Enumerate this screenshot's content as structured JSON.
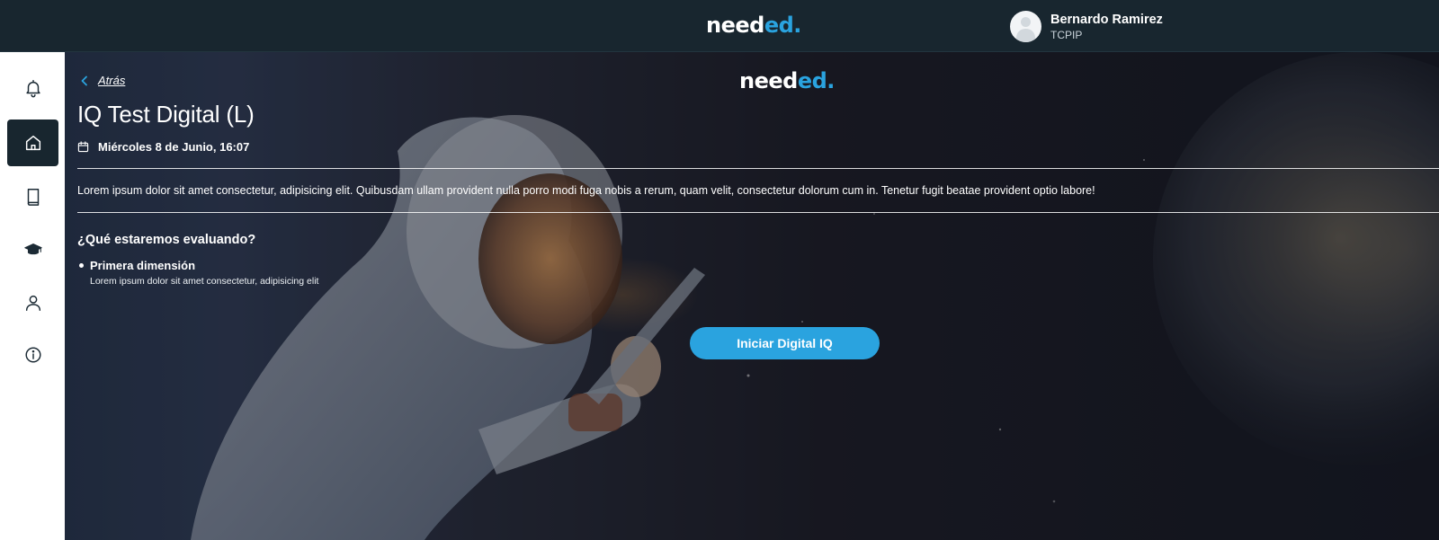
{
  "brand": {
    "logo_main": "need",
    "logo_accent": "ed."
  },
  "user": {
    "name": "Bernardo Ramirez",
    "role": "TCPIP"
  },
  "sidebar": {
    "items": [
      {
        "icon": "bell-icon",
        "active": false
      },
      {
        "icon": "home-icon",
        "active": true
      },
      {
        "icon": "book-icon",
        "active": false
      },
      {
        "icon": "graduation-cap-icon",
        "active": false
      },
      {
        "icon": "user-icon",
        "active": false
      },
      {
        "icon": "info-icon",
        "active": false
      }
    ]
  },
  "page": {
    "back_label": "Atrás",
    "title": "IQ Test Digital (L)",
    "date": "Miércoles 8 de Junio, 16:07",
    "description": "Lorem ipsum dolor sit amet consectetur, adipisicing elit. Quibusdam ullam provident nulla porro modi fuga nobis a rerum, quam velit, consectetur dolorum cum in. Tenetur fugit beatae provident optio labore!",
    "section_title": "¿Qué estaremos evaluando?",
    "dimensions": [
      {
        "title": "Primera dimensión",
        "description": "Lorem ipsum dolor sit amet consectetur, adipisicing elit"
      }
    ],
    "cta_label": "Iniciar Digital IQ"
  },
  "colors": {
    "topbar": "#18262f",
    "accent": "#2aa3df",
    "sidebar": "#ffffff",
    "text": "#ffffff"
  }
}
